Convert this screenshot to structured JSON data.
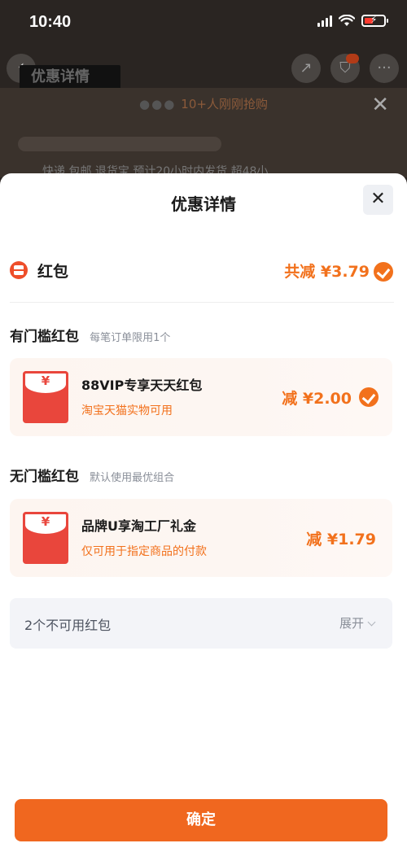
{
  "status_bar": {
    "time": "10:40"
  },
  "background": {
    "title": "优惠详情",
    "grab_text": "10+人刚刚抢购",
    "shipping_text": "快递 包邮 退货宝 预计20小时内发货 超48小"
  },
  "sheet": {
    "title": "优惠详情",
    "section": {
      "label": "红包",
      "total": "共减 ¥3.79"
    },
    "threshold_group": {
      "title": "有门槛红包",
      "note": "每笔订单限用1个",
      "coupon": {
        "symbol": "¥",
        "name": "88VIP专享天天红包",
        "desc": "淘宝天猫实物可用",
        "amount": "减 ¥2.00"
      }
    },
    "no_threshold_group": {
      "title": "无门槛红包",
      "note": "默认使用最优组合",
      "coupon": {
        "symbol": "¥",
        "name": "品牌U享淘工厂礼金",
        "desc": "仅可用于指定商品的付款",
        "amount": "减 ¥1.79"
      }
    },
    "unavailable": {
      "label": "2个不可用红包",
      "expand": "展开"
    },
    "confirm_label": "确定"
  },
  "icons": [
    "back-icon",
    "share-icon",
    "cart-icon",
    "more-icon",
    "close-icon",
    "red-envelope-icon",
    "check-icon",
    "chevron-down-icon"
  ],
  "colors": {
    "accent": "#f2711c",
    "button": "#f0671f",
    "envelope": "#e9463c"
  }
}
